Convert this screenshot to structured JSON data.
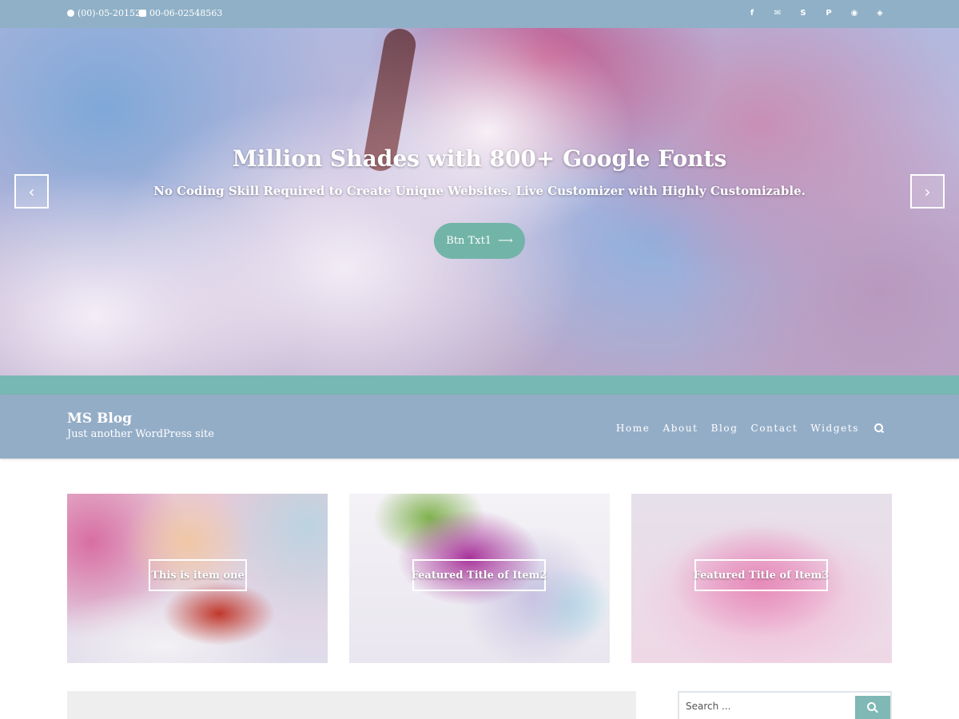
{
  "topbar": {
    "phone": "(00)-05-201526",
    "fax": "00-06-02548563",
    "social_icons": [
      "facebook-icon",
      "email-icon",
      "skype-icon",
      "pinterest-icon",
      "github-icon",
      "codepen-icon"
    ],
    "social_glyphs": [
      "f",
      "✉",
      "S",
      "P",
      "◉",
      "◈"
    ]
  },
  "hero": {
    "title": "Million Shades with 800+ Google Fonts",
    "subtitle": "No Coding Skill Required to Create Unique Websites. Live Customizer with Highly Customizable.",
    "button_label": "Btn Txt1",
    "button_arrow": "⟶",
    "prev_glyph": "‹",
    "next_glyph": "›"
  },
  "header": {
    "site_title": "MS Blog",
    "tagline": "Just another WordPress site",
    "nav": [
      "Home",
      "About",
      "Blog",
      "Contact",
      "Widgets"
    ]
  },
  "featured": [
    {
      "title": "This is item one"
    },
    {
      "title": "Featured Title of Item2"
    },
    {
      "title": "Featured Title of Item3"
    }
  ],
  "sidebar": {
    "search_placeholder": "Search ..."
  },
  "colors": {
    "topbar": "#8fb0c6",
    "accent_teal": "#72b4a8",
    "header": "#94adc7",
    "strip": "#78b8b4"
  }
}
